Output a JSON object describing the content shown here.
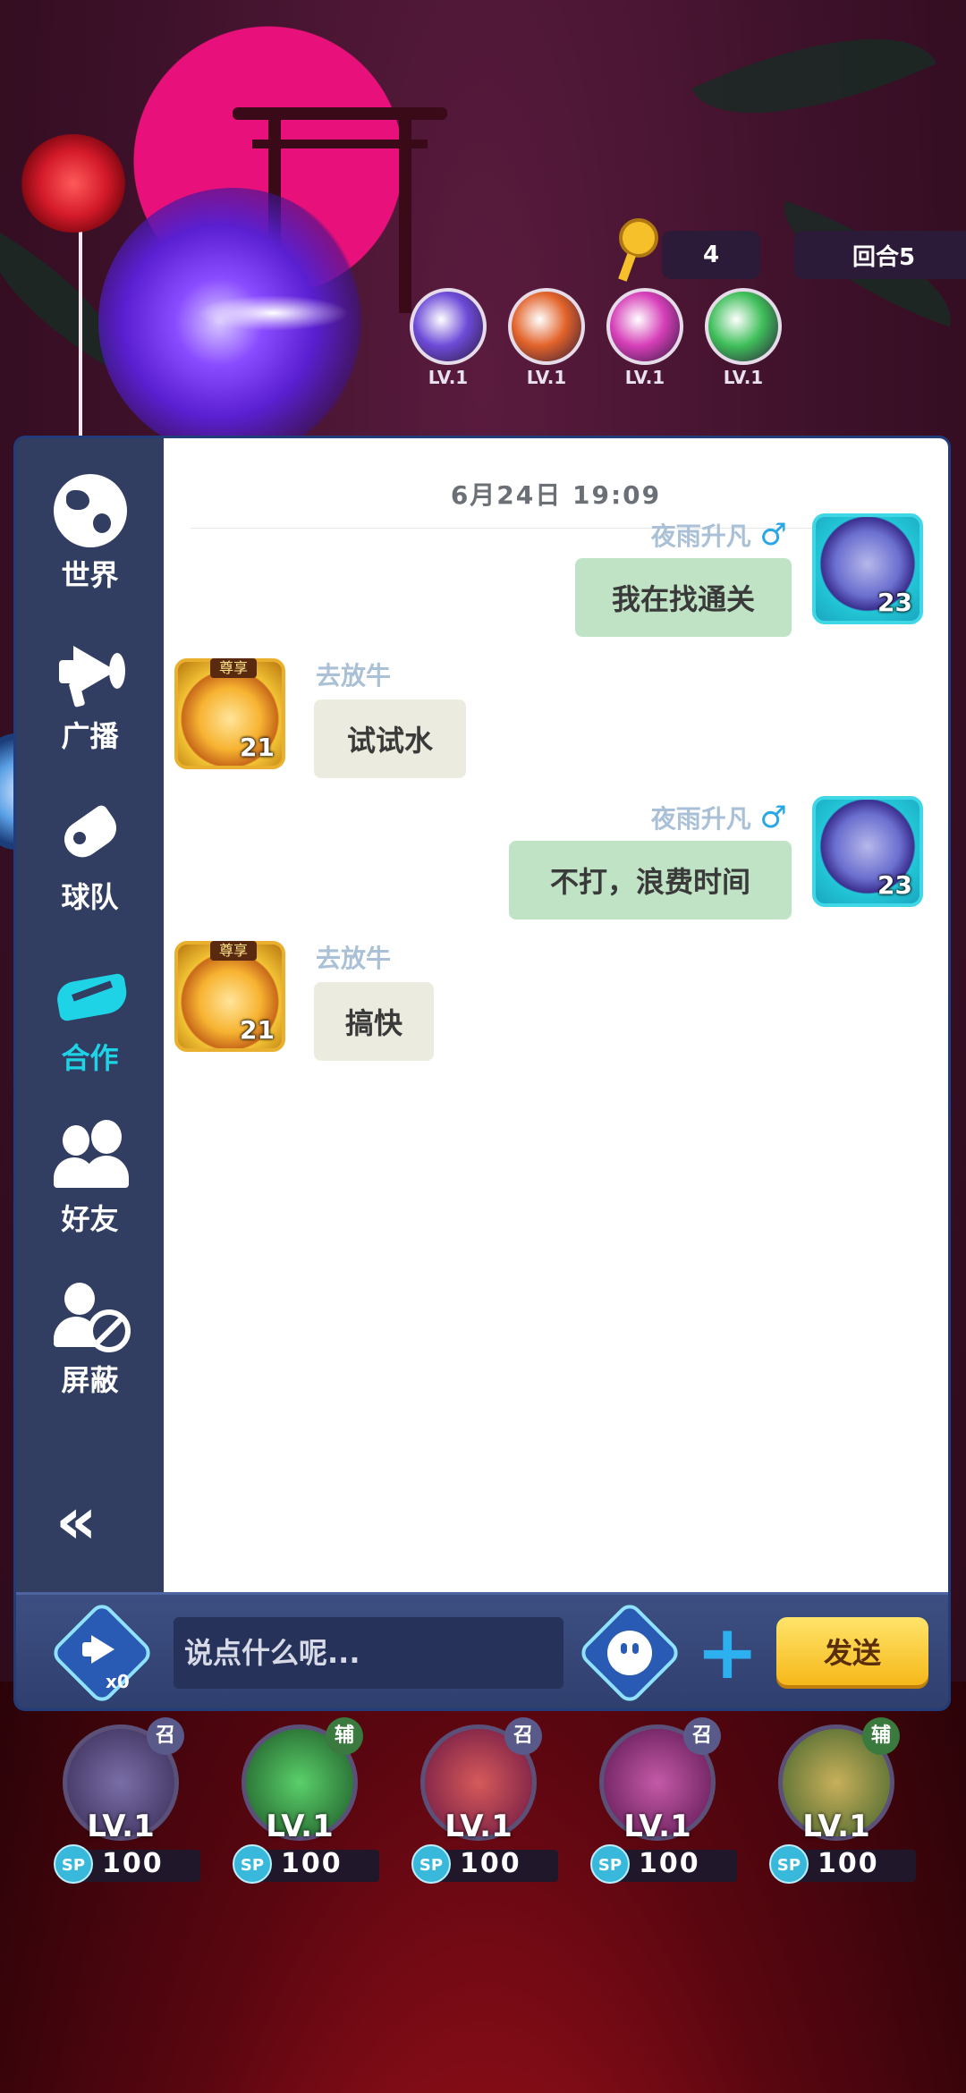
{
  "hud": {
    "key_count": "4",
    "round": "回合5",
    "skills": [
      {
        "level": "LV.1",
        "color": "#6d4bd8"
      },
      {
        "level": "LV.1",
        "color": "#e2632a"
      },
      {
        "level": "LV.1",
        "color": "#d63fb8"
      },
      {
        "level": "LV.1",
        "color": "#3fbf5a"
      }
    ]
  },
  "sidebar": {
    "items": [
      {
        "label": "世界",
        "icon": "globe-icon"
      },
      {
        "label": "广播",
        "icon": "megaphone-icon"
      },
      {
        "label": "球队",
        "icon": "whistle-icon"
      },
      {
        "label": "合作",
        "icon": "handshake-icon",
        "active": true
      },
      {
        "label": "好友",
        "icon": "friends-icon"
      },
      {
        "label": "屏蔽",
        "icon": "block-user-icon"
      }
    ],
    "collapse_label": "«",
    "active_color": "#1fd3e6"
  },
  "chat": {
    "timestamp": "6月24日 19:09",
    "messages": [
      {
        "sender": "夜雨升凡",
        "gender": "♂",
        "text": "我在找通关",
        "level": "23",
        "self": true
      },
      {
        "sender": "去放牛",
        "text": "试试水",
        "level": "21",
        "tag": "尊享",
        "self": false
      },
      {
        "sender": "夜雨升凡",
        "gender": "♂",
        "text": "不打，浪费时间",
        "level": "23",
        "self": true
      },
      {
        "sender": "去放牛",
        "text": "搞快",
        "level": "21",
        "tag": "尊享",
        "self": false
      }
    ]
  },
  "input": {
    "broadcast_count": "x0",
    "placeholder": "说点什么呢...",
    "send_label": "发送"
  },
  "cards": [
    {
      "level": "LV.1",
      "tag": "召",
      "sp_label": "SP",
      "sp": "100",
      "color": "#4b3f6e",
      "tag_color": "#5a5a8a"
    },
    {
      "level": "LV.1",
      "tag": "辅",
      "sp_label": "SP",
      "sp": "100",
      "color": "#2f7a3a",
      "tag_color": "#3b7a3e"
    },
    {
      "level": "LV.1",
      "tag": "召",
      "sp_label": "SP",
      "sp": "100",
      "color": "#8a2a4a",
      "tag_color": "#5a5a8a"
    },
    {
      "level": "LV.1",
      "tag": "召",
      "sp_label": "SP",
      "sp": "100",
      "color": "#7a2a6a",
      "tag_color": "#5a5a8a"
    },
    {
      "level": "LV.1",
      "tag": "辅",
      "sp_label": "SP",
      "sp": "100",
      "color": "#6a7a3a",
      "tag_color": "#3b7a3e"
    }
  ]
}
